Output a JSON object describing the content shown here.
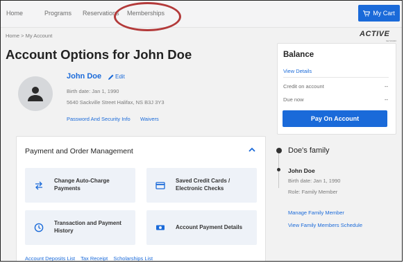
{
  "nav": {
    "items": [
      "Home",
      "Programs",
      "Reservations",
      "Memberships"
    ],
    "cart_label": "My Cart"
  },
  "breadcrumb": {
    "home": "Home",
    "separator": ">",
    "current": "My Account"
  },
  "logo": {
    "text": "ACTIVE",
    "sub": "NETWORK"
  },
  "account": {
    "title": "Account Options for John Doe",
    "name": "John Doe",
    "edit_label": "Edit",
    "birth": "Birth date: Jan 1, 1990",
    "address": "5640 Sackville Street Halifax, NS B3J 3Y3",
    "password_link": "Password And Security Info",
    "waivers_link": "Waivers"
  },
  "payment": {
    "title": "Payment and Order Management",
    "tiles": [
      {
        "line1": "Change Auto-Charge",
        "line2": "Payments",
        "icon": "swap-arrows-icon"
      },
      {
        "line1": "Saved Credit Cards /",
        "line2": "Electronic Checks",
        "icon": "credit-card-icon"
      },
      {
        "line1": "Transaction and Payment",
        "line2": "History",
        "icon": "clock-icon"
      },
      {
        "line1": "Account Payment Details",
        "line2": "",
        "icon": "money-icon"
      }
    ],
    "links": [
      "Account Deposits List",
      "Tax Receipt",
      "Scholarships List"
    ]
  },
  "balance": {
    "title": "Balance",
    "view_details": "View Details",
    "credit_label": "Credit on account",
    "credit_value": "--",
    "due_label": "Due now",
    "due_value": "--",
    "pay_button": "Pay On Account"
  },
  "family": {
    "title": "Doe's family",
    "member_name": "John Doe",
    "member_birth": "Birth date: Jan 1, 1990",
    "member_role": "Role: Family Member",
    "manage_link": "Manage Family Member",
    "schedule_link": "View Family Members Schedule"
  },
  "colors": {
    "brand_blue": "#1a6ad9",
    "annotation_red": "#b33a3a",
    "tile_bg": "#eef2f8"
  }
}
